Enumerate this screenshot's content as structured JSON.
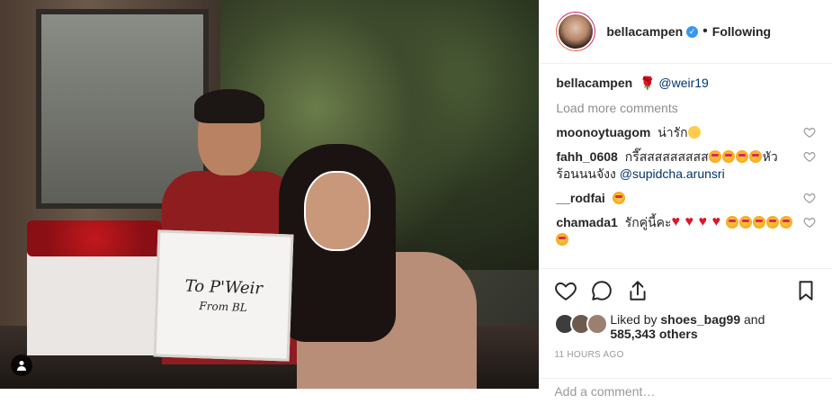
{
  "header": {
    "username": "bellacampen",
    "verified_mark": "✓",
    "dot": "•",
    "follow_label": "Following"
  },
  "photo": {
    "lid_line1": "To P'Weir",
    "lid_line2": "From BL"
  },
  "caption": {
    "username": "bellacampen",
    "emoji": "🌹",
    "mention": "@weir19"
  },
  "load_more": "Load more comments",
  "comments": [
    {
      "username": "moonoytuagom",
      "text": "น่ารัก",
      "emojis": [
        "smile"
      ]
    },
    {
      "username": "fahh_0608",
      "text": "กรี๊สสสสสสสสส",
      "emojis": [
        "star",
        "star",
        "star",
        "star"
      ],
      "suffix": "หัวร้อนนนจังง",
      "mention": "@supidcha.arunsri"
    },
    {
      "username": "__rodfai",
      "text": "",
      "emojis": [
        "star"
      ]
    },
    {
      "username": "chamada1",
      "text": "รักคู่นี้คะ",
      "emojis": [
        "heart",
        "heart",
        "heart",
        "heart",
        "star",
        "star",
        "star",
        "star",
        "star",
        "star"
      ]
    }
  ],
  "likes": {
    "prefix": "Liked by",
    "user": "shoes_bag99",
    "and": "and",
    "count": "585,343 others"
  },
  "time": "11 HOURS AGO",
  "add_comment_placeholder": "Add a comment…",
  "colors": {
    "verified": "#3897f0",
    "mention": "#003569",
    "muted": "#8e8e8e"
  }
}
